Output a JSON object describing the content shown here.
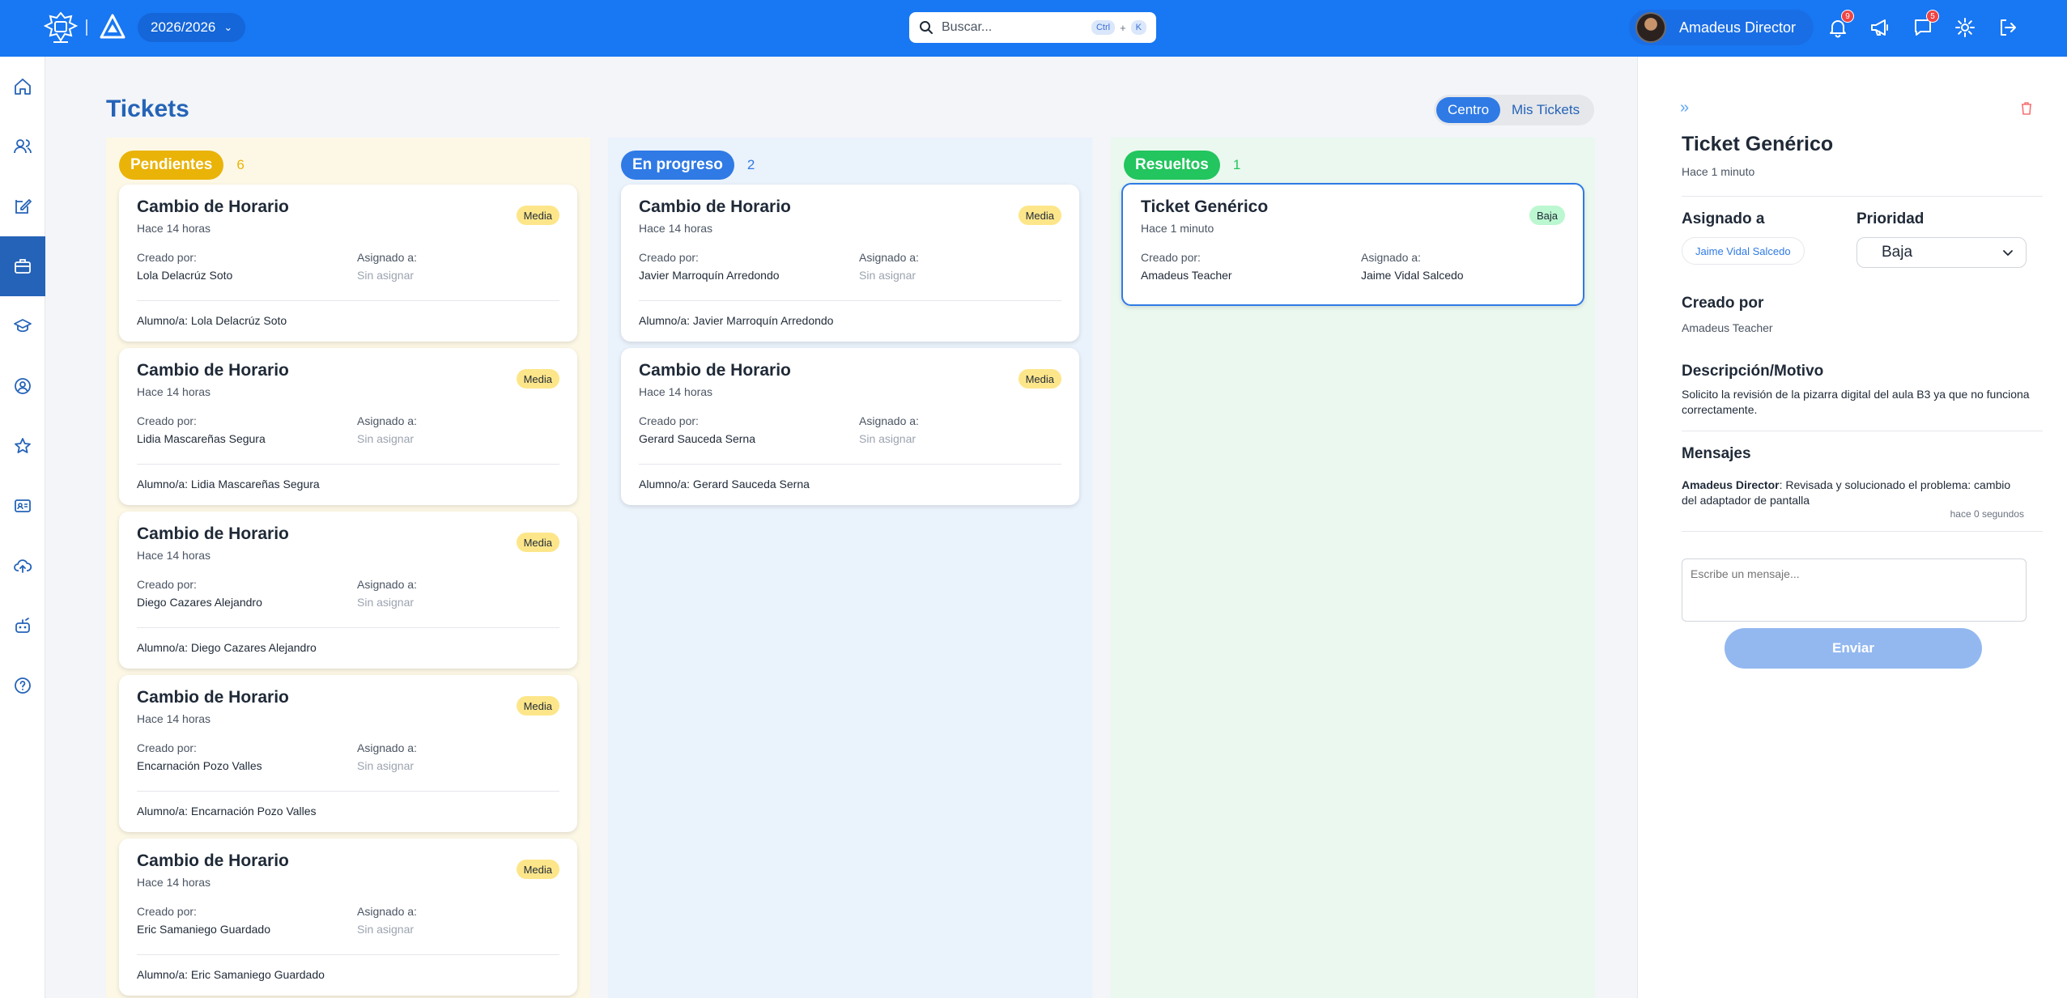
{
  "header": {
    "year": "2026/2026",
    "search_placeholder": "Buscar...",
    "kbd_ctrl": "Ctrl",
    "kbd_plus": "+",
    "kbd_k": "K",
    "user_name": "Amadeus Director",
    "notifications_badge": "9",
    "messages_badge": "5"
  },
  "page": {
    "title": "Tickets",
    "toggle": [
      "Centro",
      "Mis Tickets"
    ],
    "toggle_active": "Centro"
  },
  "columns": [
    {
      "title": "Pendientes",
      "count": "6",
      "tickets": [
        {
          "title": "Cambio de Horario",
          "time": "Hace 14 horas",
          "priority": "Media",
          "created_label": "Creado por:",
          "created_by": "Lola Delacrúz Soto",
          "assigned_label": "Asignado a:",
          "assigned_to": "Sin asignar",
          "student": "Alumno/a: Lola Delacrúz Soto"
        },
        {
          "title": "Cambio de Horario",
          "time": "Hace 14 horas",
          "priority": "Media",
          "created_label": "Creado por:",
          "created_by": "Lidia Mascareñas Segura",
          "assigned_label": "Asignado a:",
          "assigned_to": "Sin asignar",
          "student": "Alumno/a: Lidia Mascareñas Segura"
        },
        {
          "title": "Cambio de Horario",
          "time": "Hace 14 horas",
          "priority": "Media",
          "created_label": "Creado por:",
          "created_by": "Diego Cazares Alejandro",
          "assigned_label": "Asignado a:",
          "assigned_to": "Sin asignar",
          "student": "Alumno/a: Diego Cazares Alejandro"
        },
        {
          "title": "Cambio de Horario",
          "time": "Hace 14 horas",
          "priority": "Media",
          "created_label": "Creado por:",
          "created_by": "Encarnación Pozo Valles",
          "assigned_label": "Asignado a:",
          "assigned_to": "Sin asignar",
          "student": "Alumno/a: Encarnación Pozo Valles"
        },
        {
          "title": "Cambio de Horario",
          "time": "Hace 14 horas",
          "priority": "Media",
          "created_label": "Creado por:",
          "created_by": "Eric Samaniego Guardado",
          "assigned_label": "Asignado a:",
          "assigned_to": "Sin asignar",
          "student": "Alumno/a: Eric Samaniego Guardado"
        }
      ]
    },
    {
      "title": "En progreso",
      "count": "2",
      "tickets": [
        {
          "title": "Cambio de Horario",
          "time": "Hace 14 horas",
          "priority": "Media",
          "created_label": "Creado por:",
          "created_by": "Javier Marroquín Arredondo",
          "assigned_label": "Asignado a:",
          "assigned_to": "Sin asignar",
          "student": "Alumno/a: Javier Marroquín Arredondo"
        },
        {
          "title": "Cambio de Horario",
          "time": "Hace 14 horas",
          "priority": "Media",
          "created_label": "Creado por:",
          "created_by": "Gerard Sauceda Serna",
          "assigned_label": "Asignado a:",
          "assigned_to": "Sin asignar",
          "student": "Alumno/a: Gerard Sauceda Serna"
        }
      ]
    },
    {
      "title": "Resueltos",
      "count": "1",
      "tickets": [
        {
          "title": "Ticket Genérico",
          "time": "Hace 1 minuto",
          "priority": "Baja",
          "created_label": "Creado por:",
          "created_by": "Amadeus Teacher",
          "assigned_label": "Asignado a:",
          "assigned_to": "Jaime Vidal Salcedo"
        }
      ]
    }
  ],
  "panel": {
    "title": "Ticket Genérico",
    "time": "Hace 1 minuto",
    "assigned_heading": "Asignado a",
    "assigned_to": "Jaime Vidal Salcedo",
    "priority_heading": "Prioridad",
    "priority_value": "Baja",
    "created_heading": "Creado por",
    "created_by": "Amadeus Teacher",
    "description_heading": "Descripción/Motivo",
    "description": "Solicito la revisión de la pizarra digital del aula B3 ya que no funciona correctamente.",
    "messages_heading": "Mensajes",
    "message_author": "Amadeus Director",
    "message_text": ": Revisada y solucionado el problema: cambio del adaptador de pantalla",
    "message_time": "hace 0 segundos",
    "input_placeholder": "Escribe un mensaje...",
    "send_label": "Enviar"
  },
  "colors": {
    "brand": "#1877f2",
    "pending": "#eab308",
    "progress": "#2f7ae5",
    "resolved": "#22c55e"
  }
}
